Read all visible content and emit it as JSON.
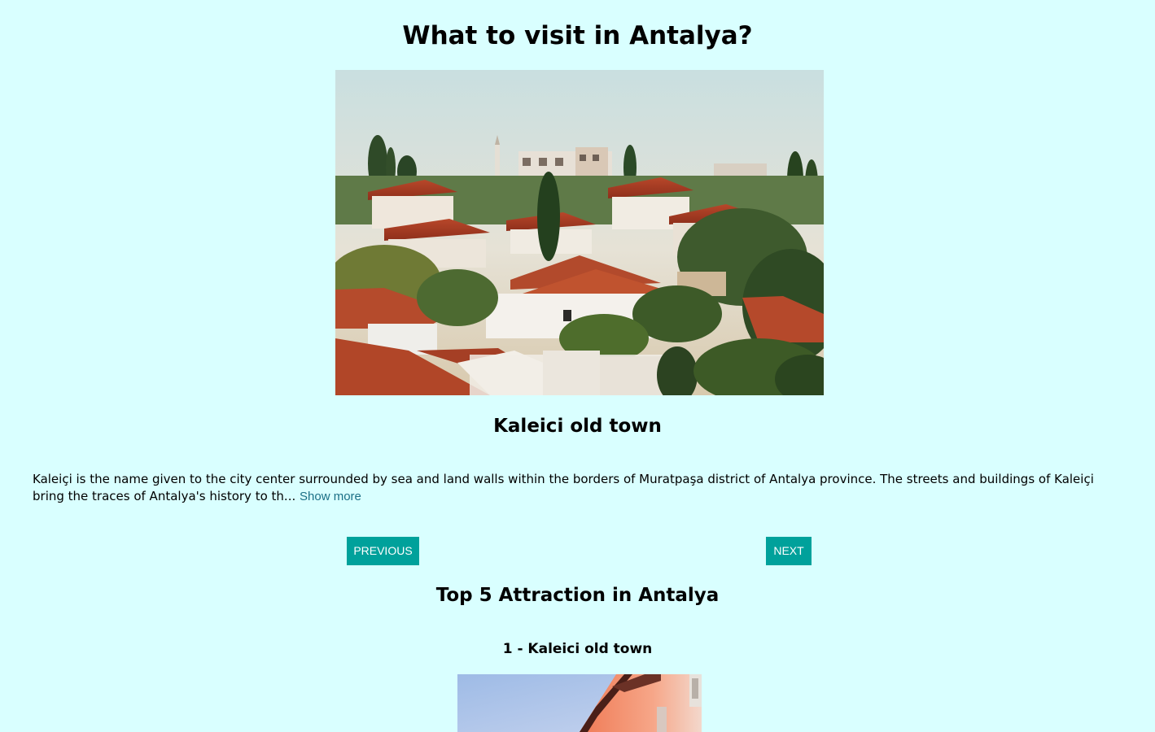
{
  "page": {
    "title": "What to visit in Antalya?"
  },
  "carousel": {
    "image": {
      "alt": "Kaleici old town"
    },
    "attraction_title": "Kaleici old town",
    "description": "Kaleiçi is the name given to the city center surrounded by sea and land walls within the borders of Muratpaşa district of Antalya province. The streets and buildings of Kaleiçi bring the traces of Antalya's history to th...",
    "show_more_label": "Show more",
    "previous_label": "PREVIOUS",
    "next_label": "NEXT"
  },
  "top_list": {
    "title": "Top 5 Attraction in Antalya",
    "items": [
      {
        "title": "1 - Kaleici old town",
        "image_alt": "Kaleici old town street"
      }
    ]
  },
  "colors": {
    "background": "#d9ffff",
    "button": "#00a19b",
    "button_text": "#ffffff",
    "link": "#1b6f86"
  }
}
